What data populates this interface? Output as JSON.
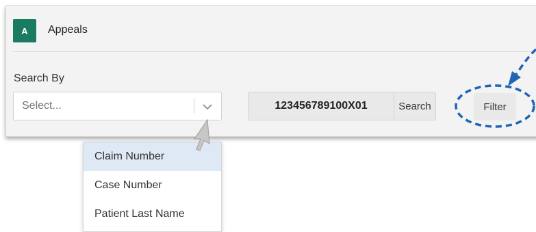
{
  "app": {
    "badge_letter": "A",
    "title": "Appeals"
  },
  "search": {
    "label": "Search By",
    "select_placeholder": "Select...",
    "claim_value": "123456789100X01",
    "search_button": "Search",
    "filter_button": "Filter"
  },
  "dropdown": {
    "items": [
      {
        "label": "Claim Number",
        "highlighted": true
      },
      {
        "label": "Case Number",
        "highlighted": false
      },
      {
        "label": "Patient Last Name",
        "highlighted": false
      }
    ]
  },
  "annotations": {
    "callout_color": "#1f66b3",
    "cursor_icon": "mouse-cursor-icon"
  },
  "colors": {
    "brand": "#1a7a62",
    "panel_bg": "#f3f3f3",
    "highlight": "#dfe8f5"
  }
}
